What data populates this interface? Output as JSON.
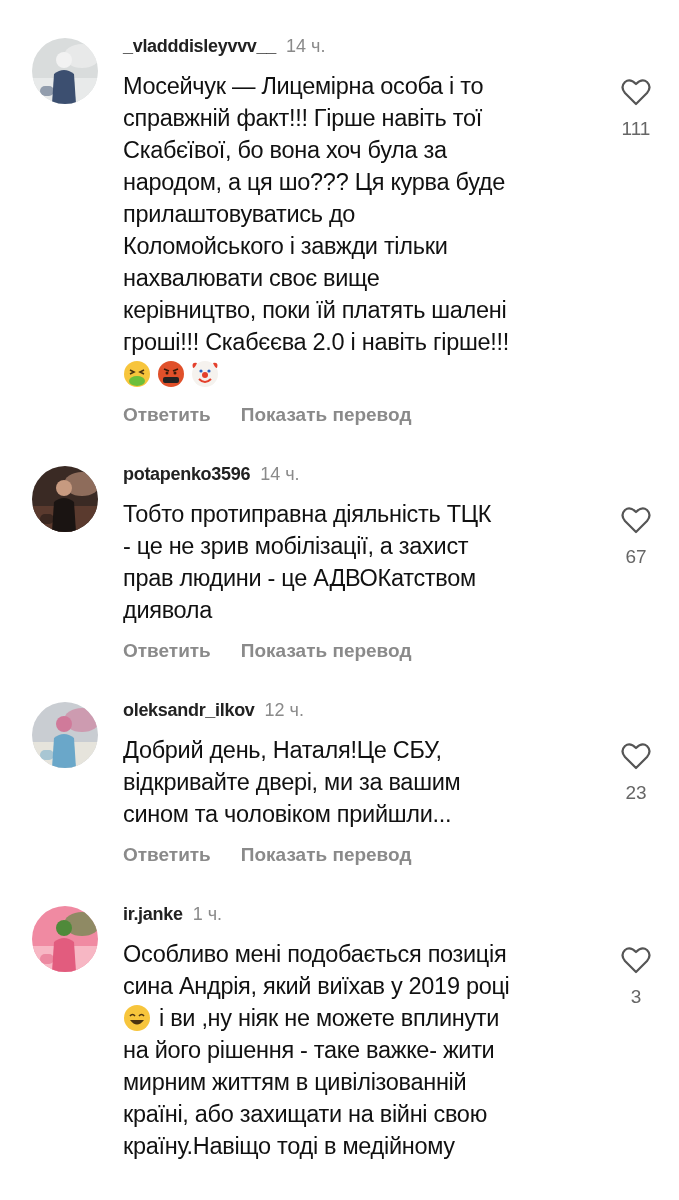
{
  "comments": [
    {
      "username": "_vladddisleyvvv__",
      "time": "14 ч.",
      "avatar": {
        "kind": "picture"
      },
      "likes": "111",
      "lines": [
        {
          "text": "Мосейчук — Лицемірна особа і то"
        },
        {
          "text": "справжній факт!!! Гірше навіть тої"
        },
        {
          "text": "Скабєївої, бо вона хоч була за"
        },
        {
          "text": "народом, а ця шо??? Ця курва буде"
        },
        {
          "text": "прилаштовуватись до"
        },
        {
          "text": "Коломойського і завжди тільки"
        },
        {
          "text": "нахвалювати своє вище"
        },
        {
          "text": "керівництво, поки їй платять шалені"
        },
        {
          "text": "гроші!!! Скабєєва 2.0 і навіть гірше!!!"
        },
        {
          "emoji": [
            {
              "kind": "vomiting-face"
            },
            {
              "kind": "cursing-face"
            },
            {
              "kind": "clown-face"
            }
          ]
        }
      ],
      "reply": "Ответить",
      "translate": "Показать перевод"
    },
    {
      "username": "potapenko3596",
      "time": "14 ч.",
      "avatar": {
        "kind": "picture"
      },
      "likes": "67",
      "lines": [
        {
          "text": "Тобто протиправна  діяльність ТЦК"
        },
        {
          "text": "- це не зрив мобілізації, а захист"
        },
        {
          "text": "прав людини - це АДВОКатством"
        },
        {
          "text": "диявола"
        }
      ],
      "reply": "Ответить",
      "translate": "Показать перевод"
    },
    {
      "username": "oleksandr_ilkov",
      "time": "12 ч.",
      "avatar": {
        "kind": "picture"
      },
      "likes": "23",
      "lines": [
        {
          "text": "Добрий день, Наталя!Це СБУ,"
        },
        {
          "text": "відкривайте двері, ми за вашим"
        },
        {
          "text": "сином та чоловіком прийшли..."
        }
      ],
      "reply": "Ответить",
      "translate": "Показать перевод"
    },
    {
      "username": "ir.janke",
      "time": "1 ч.",
      "avatar": {
        "kind": "picture"
      },
      "likes": "3",
      "lines": [
        {
          "text": "Особливо мені подобається позиція"
        },
        {
          "text": "сина Андрія, який виїхав у 2019 році"
        },
        {
          "emoji": [
            {
              "kind": "grinning-face"
            }
          ],
          "text": "і ви ,ну ніяк не можете вплинути"
        },
        {
          "text": "на його рішення - таке важке- жити"
        },
        {
          "text": "мирним життям в цивілізованній"
        },
        {
          "text": "країні, або захищати на війні свою"
        },
        {
          "text": "країну.Навіщо тоді в медійному"
        }
      ]
    }
  ]
}
